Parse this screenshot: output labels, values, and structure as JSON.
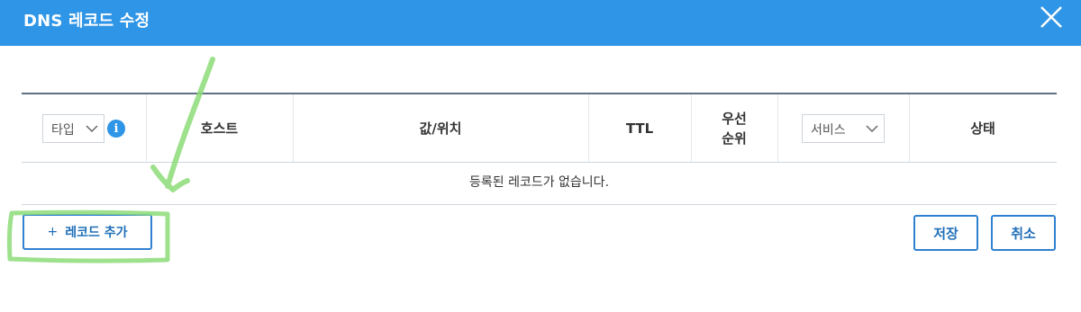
{
  "dialog": {
    "title": "DNS 레코드 수정",
    "close_icon": "close-icon"
  },
  "table": {
    "headers": {
      "type_select": "타입",
      "host": "호스트",
      "value": "값/위치",
      "ttl": "TTL",
      "priority": "우선\n순위",
      "service_select": "서비스",
      "status": "상태"
    },
    "empty_message": "등록된 레코드가 없습니다."
  },
  "actions": {
    "add_record_icon": "+",
    "add_record_label": "레코드 추가",
    "save_label": "저장",
    "cancel_label": "취소"
  },
  "colors": {
    "titlebar": "#2f95e6",
    "button_text": "#1f6fb8",
    "annotation": "#7fd66b"
  }
}
